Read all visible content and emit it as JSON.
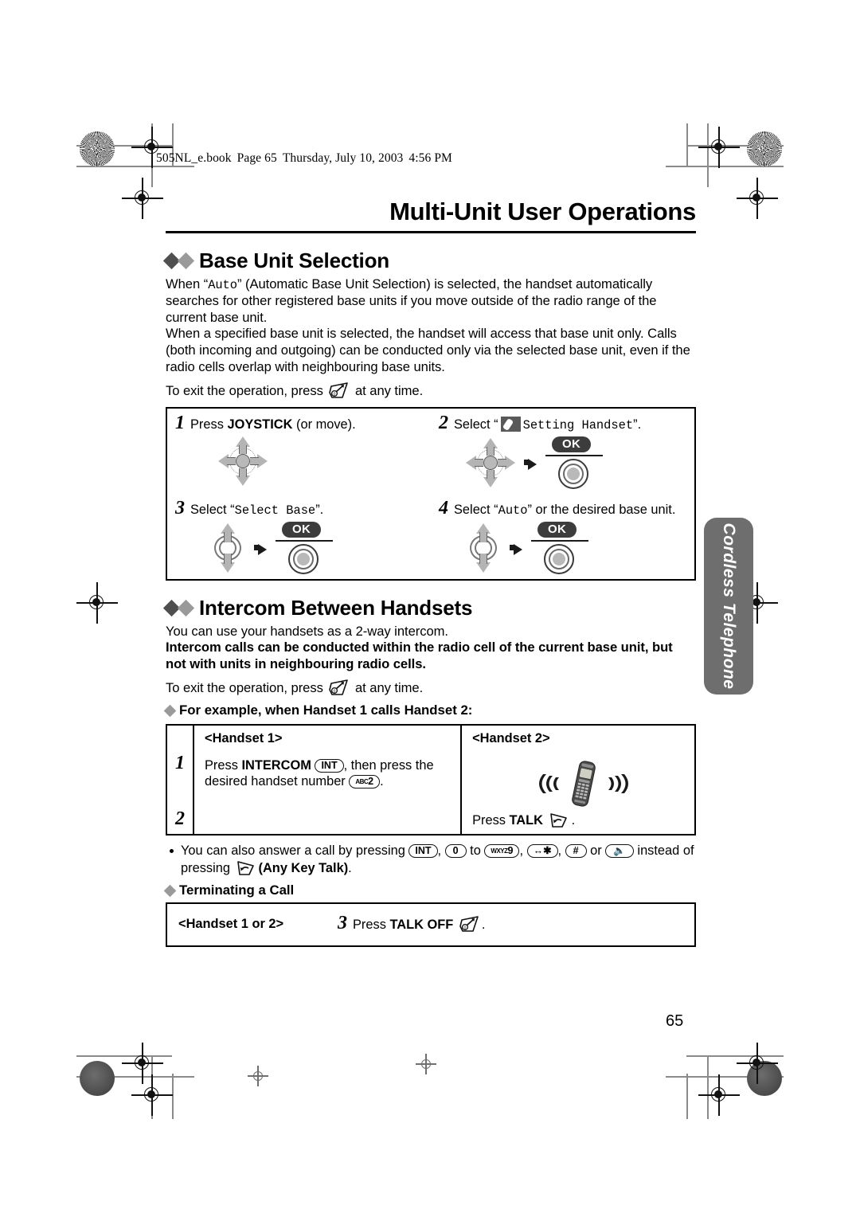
{
  "print_slug": {
    "file": "505NL_e.book",
    "page": "Page 65",
    "date": "Thursday, July 10, 2003",
    "time": "4:56 PM"
  },
  "chapter_title": "Multi-Unit User Operations",
  "page_number": "65",
  "side_tab": "Cordless Telephone",
  "section_base_unit": {
    "heading": "Base Unit Selection",
    "paragraph1_a": "When “",
    "paragraph1_mono": "Auto",
    "paragraph1_b": "” (Automatic Base Unit Selection) is selected, the handset automatically searches for other registered base units if you move outside of the radio range of the current base unit.",
    "paragraph2": "When a specified base unit is selected, the handset will access that base unit only. Calls (both incoming and outgoing) can be conducted only via the selected base unit, even if the radio cells overlap with neighbouring base units.",
    "exit_prefix": "To exit the operation, press",
    "exit_suffix": "at any time.",
    "steps": [
      {
        "number": "1",
        "text_a": "Press ",
        "text_bold": "JOYSTICK",
        "text_b": " (or move).",
        "icons": "joystick-4way"
      },
      {
        "number": "2",
        "text_a": "Select “",
        "text_mono": "Setting Handset",
        "text_b": "”.",
        "icons": "joystick-4way + ok"
      },
      {
        "number": "3",
        "text_a": "Select “",
        "text_mono": "Select Base",
        "text_b": "”.",
        "icons": "joystick-updown + ok"
      },
      {
        "number": "4",
        "text_a": "Select “",
        "text_mono": "Auto",
        "text_b": "” or the desired base unit.",
        "icons": "joystick-updown + ok"
      }
    ],
    "ok_label": "OK"
  },
  "section_intercom": {
    "heading": "Intercom Between Handsets",
    "paragraph1": "You can use your handsets as a 2-way intercom.",
    "paragraph_bold": "Intercom calls can be conducted within the radio cell of the current base unit, but not with units in neighbouring radio cells.",
    "exit_prefix": "To exit the operation, press",
    "exit_suffix": "at any time.",
    "example_heading": "For example, when Handset 1 calls Handset 2:",
    "table": {
      "col1_header": "<Handset 1>",
      "col2_header": "<Handset 2>",
      "row1_number": "1",
      "row1_col1_a": "Press ",
      "row1_col1_bold": "INTERCOM",
      "row1_col1_key": "INT",
      "row1_col1_b": ", then press the desired handset number ",
      "row1_col1_key2_sub": "ABC",
      "row1_col1_key2_num": "2",
      "row1_col1_c": ".",
      "row1_col2_icon": "ringing-handset",
      "row2_number": "2",
      "row2_col2_a": "Press ",
      "row2_col2_bold": "TALK",
      "row2_col2_b": "."
    },
    "note_a": "You can also answer a call by pressing ",
    "note_keys": [
      "INT",
      "0",
      "WXYZ9",
      "*",
      "#",
      "speaker"
    ],
    "note_to": " to ",
    "note_or": " or ",
    "note_b": " instead of pressing ",
    "note_c": "(Any Key Talk)",
    "note_d": ".",
    "terminating_heading": "Terminating a Call",
    "terminating_label": "<Handset 1 or 2>",
    "terminating_number": "3",
    "terminating_a": "Press ",
    "terminating_bold": "TALK OFF",
    "terminating_b": "."
  }
}
